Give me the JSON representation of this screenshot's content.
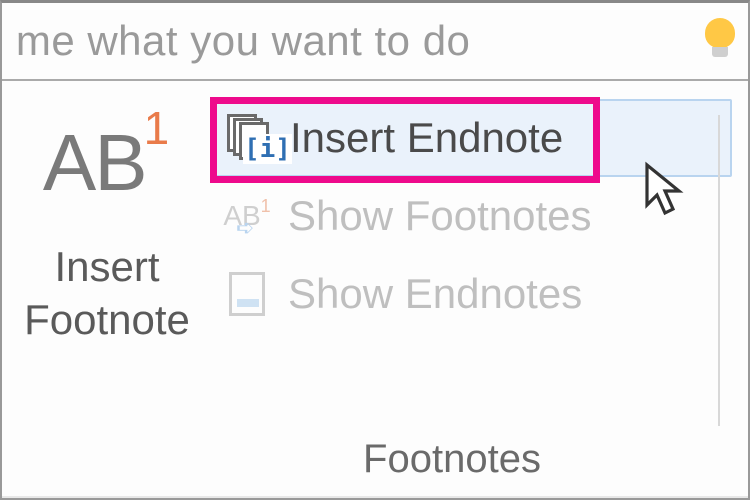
{
  "tellme": {
    "placeholder": "ll me what you want to do"
  },
  "footnotes_group": {
    "label": "Footnotes",
    "insert_footnote": {
      "label_line1": "Insert",
      "label_line2": "Footnote",
      "icon_text": "AB",
      "icon_sup": "1"
    },
    "insert_endnote": {
      "label": "Insert Endnote",
      "icon_bracket": "[i]"
    },
    "show_footnotes": {
      "label": "Show Footnotes",
      "icon_text": "AB",
      "icon_sup": "1"
    },
    "show_endnotes": {
      "label": "Show Endnotes"
    }
  }
}
